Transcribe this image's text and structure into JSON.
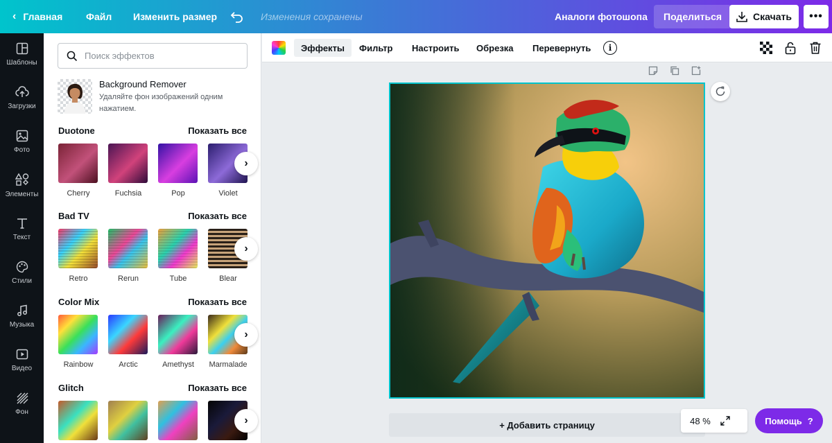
{
  "topbar": {
    "home": "Главная",
    "file": "Файл",
    "resize": "Изменить размер",
    "saved_status": "Изменения сохранены",
    "doc_title": "Аналоги фотошопа",
    "share": "Поделиться",
    "download": "Скачать",
    "more": "•••"
  },
  "rail": [
    {
      "label": "Шаблоны",
      "icon": "templates-icon"
    },
    {
      "label": "Загрузки",
      "icon": "upload-cloud-icon"
    },
    {
      "label": "Фото",
      "icon": "photo-icon"
    },
    {
      "label": "Элементы",
      "icon": "shapes-icon"
    },
    {
      "label": "Текст",
      "icon": "text-icon"
    },
    {
      "label": "Стили",
      "icon": "palette-icon"
    },
    {
      "label": "Музыка",
      "icon": "music-note-icon"
    },
    {
      "label": "Видео",
      "icon": "video-icon"
    },
    {
      "label": "Фон",
      "icon": "background-pattern-icon"
    }
  ],
  "panel": {
    "search_placeholder": "Поиск эффектов",
    "bg_remover": {
      "title": "Background Remover",
      "description": "Удаляйте фон изображений одним нажатием."
    },
    "show_all": "Показать все",
    "sections": [
      {
        "title": "Duotone",
        "items": [
          "Cherry",
          "Fuchsia",
          "Pop",
          "Violet"
        ]
      },
      {
        "title": "Bad TV",
        "items": [
          "Retro",
          "Rerun",
          "Tube",
          "Blear"
        ]
      },
      {
        "title": "Color Mix",
        "items": [
          "Rainbow",
          "Arctic",
          "Amethyst",
          "Marmalade"
        ]
      },
      {
        "title": "Glitch",
        "items": [
          "",
          "",
          "",
          ""
        ]
      }
    ]
  },
  "editor_toolbar": {
    "effects": "Эффекты",
    "filter": "Фильтр",
    "adjust": "Настроить",
    "crop": "Обрезка",
    "flip": "Перевернуть",
    "info": "i"
  },
  "canvas": {
    "add_page": "+ Добавить страницу",
    "zoom": "48 %"
  },
  "help": {
    "label": "Помощь",
    "mark": "?"
  },
  "colors": {
    "accent": "#7d2ae8",
    "selection": "#00c4cc",
    "rail_bg": "#0e1318"
  }
}
